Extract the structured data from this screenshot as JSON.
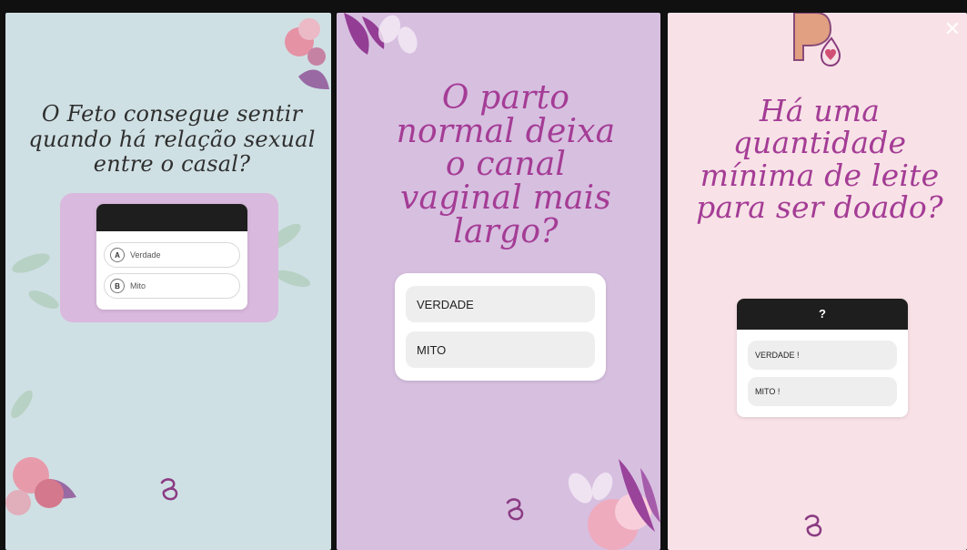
{
  "panels": [
    {
      "question": "O Feto consegue sentir quando há relação sexual entre o casal?",
      "quiz": {
        "title": "",
        "options": [
          {
            "letter": "A",
            "label": "Verdade"
          },
          {
            "letter": "B",
            "label": "Mito"
          }
        ]
      },
      "colors": {
        "background": "#cfe0e4",
        "accent": "#2f2f2f"
      }
    },
    {
      "question": "O parto normal deixa o canal vaginal mais largo?",
      "quiz": {
        "options": [
          {
            "label": "VERDADE"
          },
          {
            "label": "MITO"
          }
        ]
      },
      "colors": {
        "background": "#d7bfe0",
        "accent": "#a43c95"
      }
    },
    {
      "question": "Há uma quantidade mínima de leite para ser doado?",
      "quiz": {
        "title": "?",
        "options": [
          {
            "label": "VERDADE !"
          },
          {
            "label": "MITO !"
          }
        ]
      },
      "colors": {
        "background": "#f8e2e7",
        "accent": "#a43c95"
      }
    }
  ],
  "icons": {
    "brand": "maternity-logo-icon",
    "close": "close-icon",
    "top_logo": "drop-heart-logo-icon"
  }
}
